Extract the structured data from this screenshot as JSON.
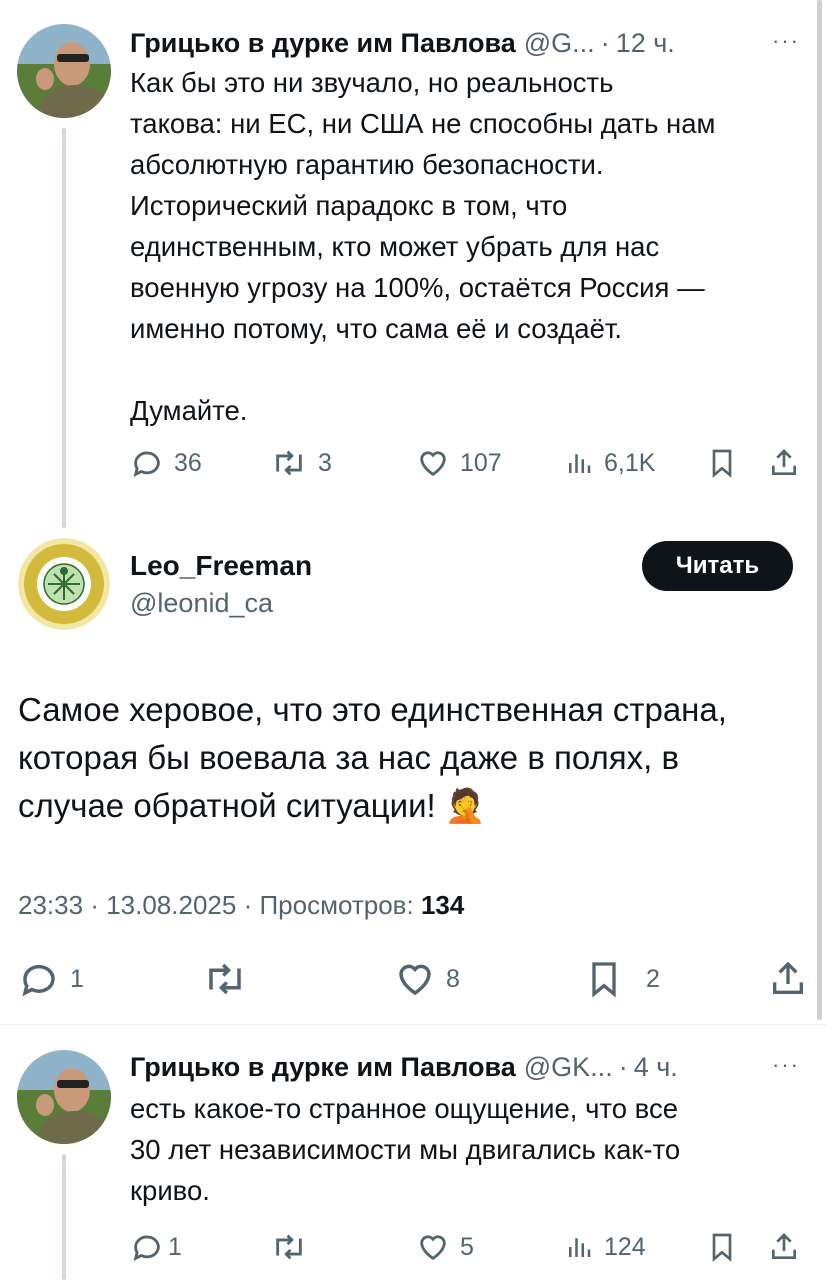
{
  "tweet1": {
    "name": "Грицько в дурке им Павлова",
    "handle": "@G...",
    "dot": "·",
    "time": "12 ч.",
    "more": "···",
    "text": "Как бы это ни звучало, но реальность\nтакова: ни ЕС, ни США не способны дать нам\nабсолютную гарантию безопасности.\nИсторический парадокс в том, что\nединственным, кто может убрать для нас\nвоенную угрозу на 100%, остаётся Россия —\nименно потому, что сама её и создаёт.\n\nДумайте.",
    "replies": "36",
    "retweets": "3",
    "likes": "107",
    "views": "6,1K"
  },
  "main": {
    "name": "Leo_Freeman",
    "handle": "@leonid_ca",
    "follow_label": "Читать",
    "avatar_text": "I AM A WORLD CITIZEN",
    "text": "Самое херовое, что это единственная страна,\nкоторая бы воевала за нас даже в полях, в\nслучае обратной ситуации! 🤦",
    "time": "23:33",
    "date": "13.08.2025",
    "views_label": "Просмотров:",
    "views": "134",
    "replies": "1",
    "likes": "8",
    "bookmarks": "2"
  },
  "tweet3": {
    "name": "Грицько в дурке им Павлова",
    "handle": "@GK...",
    "dot": "·",
    "time": "4 ч.",
    "more": "···",
    "text": "есть какое-то странное ощущение, что все\n30 лет независимости мы двигались как-то\nкриво.",
    "replies": "1",
    "likes": "5",
    "views": "124"
  },
  "colors": {
    "text": "#0f1419",
    "secondary": "#536471",
    "button_bg": "#0f1419",
    "thread_line": "#cfd9de"
  }
}
